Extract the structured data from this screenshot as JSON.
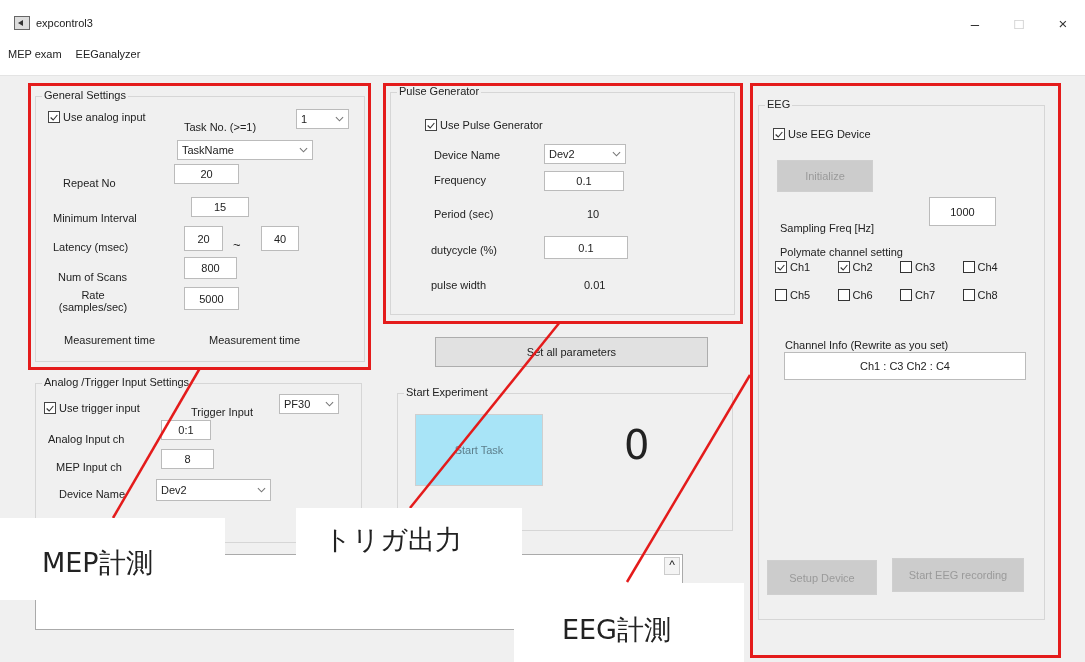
{
  "window": {
    "title": "expcontrol3",
    "controls": [
      {
        "glyph": "–",
        "disabled": false
      },
      {
        "glyph": "□",
        "disabled": true
      },
      {
        "glyph": "×",
        "disabled": false
      }
    ]
  },
  "menu": [
    {
      "label": "MEP exam"
    },
    {
      "label": "EEGanalyzer"
    }
  ],
  "general_settings": {
    "title": "General Settings",
    "use_analog": {
      "label": "Use analog input",
      "checked": true
    },
    "task_no": {
      "label": "Task No. (>=1)",
      "value": "1"
    },
    "task_name": {
      "value": "TaskName"
    },
    "repeat": {
      "label": "Repeat No",
      "value": "20"
    },
    "min_interval": {
      "label": "Minimum Interval",
      "value": "15"
    },
    "latency": {
      "label": "Latency (msec)",
      "from": "20",
      "separator": "~",
      "to": "40"
    },
    "num_scans": {
      "label": "Num of Scans",
      "value": "800"
    },
    "rate": {
      "label": "Rate (samples/sec)",
      "value": "5000"
    },
    "measurement": [
      "Measurement time",
      "Measurement time"
    ]
  },
  "trigger_settings": {
    "title": "Analog /Trigger Input Settings",
    "use_trigger": {
      "label": "Use trigger input",
      "checked": true
    },
    "trigger_input": {
      "label": "Trigger Input",
      "value": "PF30"
    },
    "analog_ch": {
      "label": "Analog Input ch",
      "value": "0:1"
    },
    "mep_ch": {
      "label": "MEP Input ch",
      "value": "8"
    },
    "device": {
      "label": "Device Name",
      "value": "Dev2"
    }
  },
  "pulse_generator": {
    "title": "Pulse Generator",
    "use_pulse": {
      "label": "Use Pulse Generator",
      "checked": true
    },
    "device": {
      "label": "Device Name",
      "value": "Dev2"
    },
    "frequency": {
      "label": "Frequency",
      "value": "0.1"
    },
    "period": {
      "label": "Period (sec)",
      "value": "10"
    },
    "dutycycle": {
      "label": "dutycycle (%)",
      "value": "0.1"
    },
    "pulse_width": {
      "label": "pulse width",
      "value": "0.01"
    }
  },
  "set_all": {
    "label": "Set all parameters",
    "disabled": false
  },
  "experiment": {
    "title": "Start Experiment",
    "start": {
      "label": "Start Task",
      "disabled": true
    },
    "count": "0"
  },
  "eeg": {
    "title": "EEG",
    "use_eeg": {
      "label": "Use EEG Device",
      "checked": true
    },
    "initialize": {
      "label": "Initialize",
      "disabled": true
    },
    "sampling": {
      "label": "Sampling Freq [Hz]",
      "value": "1000"
    },
    "channel_setting": "Polymate channel setting",
    "channels": [
      {
        "label": "Ch1",
        "checked": true
      },
      {
        "label": "Ch2",
        "checked": true
      },
      {
        "label": "Ch3",
        "checked": false
      },
      {
        "label": "Ch4",
        "checked": false
      },
      {
        "label": "Ch5",
        "checked": false
      },
      {
        "label": "Ch6",
        "checked": false
      },
      {
        "label": "Ch7",
        "checked": false
      },
      {
        "label": "Ch8",
        "checked": false
      }
    ],
    "channel_info": {
      "label": "Channel Info (Rewrite as you set)",
      "value": "Ch1 : C3  Ch2 : C4"
    },
    "setup": {
      "label": "Setup Device",
      "disabled": true
    },
    "record": {
      "label": "Start EEG recording",
      "disabled": true
    }
  },
  "log_scroll": {
    "glyph": "^"
  },
  "annotations": [
    {
      "text": "MEP計測"
    },
    {
      "text": "トリガ出力"
    },
    {
      "text": "EEG計測"
    }
  ]
}
